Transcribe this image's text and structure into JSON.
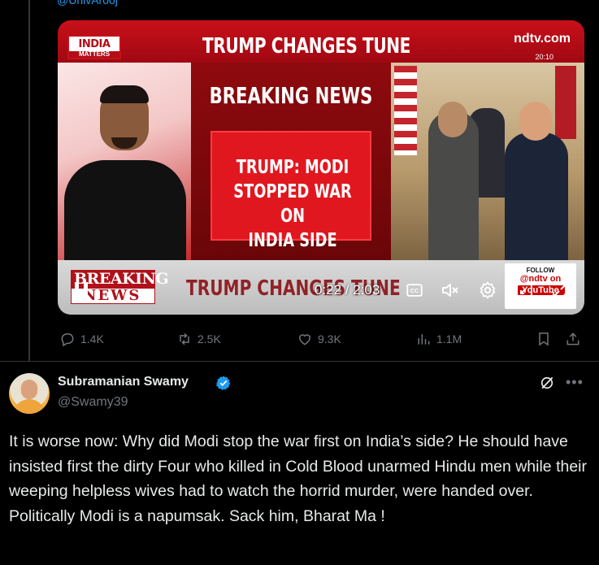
{
  "quoted": {
    "handle_fragment": "@UnivArooj"
  },
  "video": {
    "logo_line1": "INDIA",
    "logo_line2": "MATTERS",
    "headline": "TRUMP CHANGES TUNE",
    "brand": "ndtv.com",
    "clock": "20:10",
    "breaking_title": "BREAKING NEWS",
    "breaking_text": "TRUMP: MODI\nSTOPPED WAR ON\nINDIA SIDE",
    "ticker_logo_top": "BREAKING",
    "ticker_logo_bottom": "NEWS",
    "ticker_text": "TRUMP CHANGES TUNE",
    "follow_label": "FOLLOW",
    "follow_handle": "@ndtv on",
    "follow_platform": "YouTube",
    "time": "0:22 / 2:03",
    "progress": 0.18
  },
  "actions": {
    "replies": "1.4K",
    "reposts": "2.5K",
    "likes": "9.3K",
    "views": "1.1M"
  },
  "tweet": {
    "name": "Subramanian Swamy",
    "handle": "@Swamy39",
    "text": "It is worse now: Why did Modi stop the war first on India’s side? He should have insisted first the dirty Four who killed in Cold Blood unarmed Hindu men while their weeping helpless wives had to watch the horrid murder, were handed over. Politically Modi is a napumsak. Sack him, Bharat Ma !"
  },
  "colors": {
    "accent": "#1d9bf0",
    "muted": "#71767b",
    "background": "#000000",
    "text": "#e7e9ea"
  }
}
